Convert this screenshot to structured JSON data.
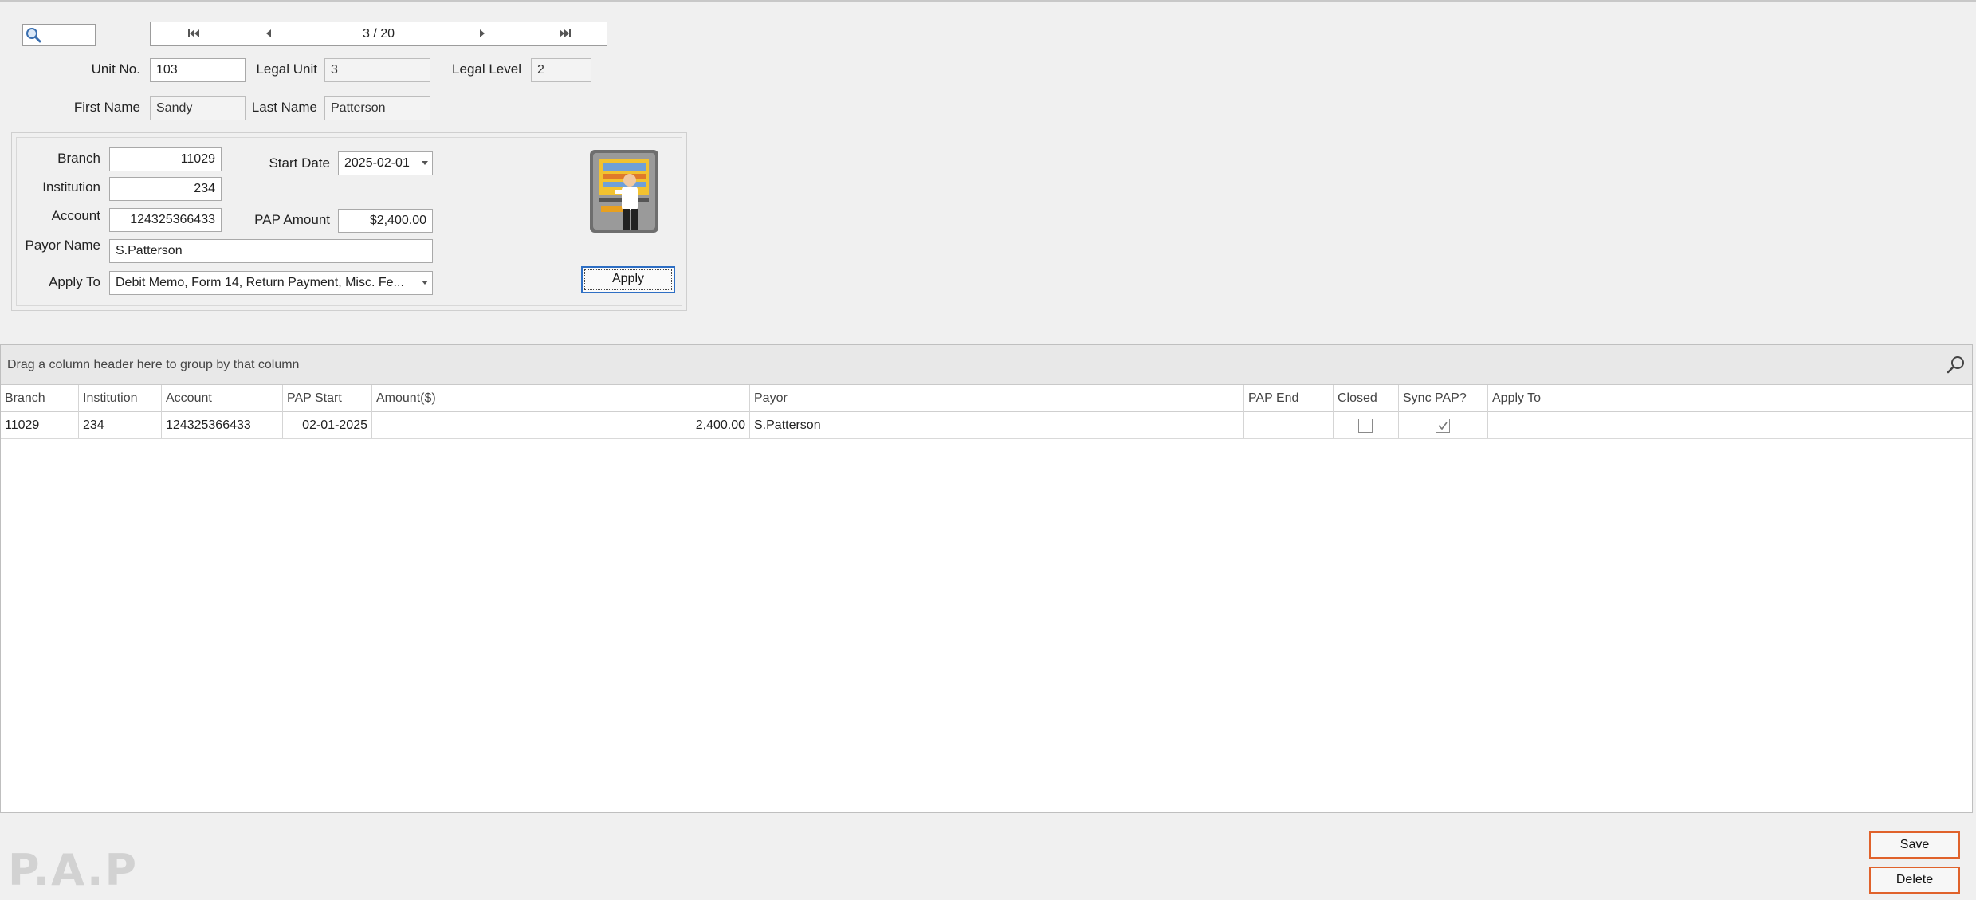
{
  "navigator": {
    "counter": "3 / 20",
    "first_icon": "first-record-icon",
    "prev_icon": "previous-record-icon",
    "next_icon": "next-record-icon",
    "last_icon": "last-record-icon",
    "search_icon": "magnifier-icon"
  },
  "unit": {
    "unit_no_label": "Unit No.",
    "unit_no": "103",
    "legal_unit_label": "Legal Unit",
    "legal_unit": "3",
    "legal_level_label": "Legal Level",
    "legal_level": "2",
    "first_name_label": "First Name",
    "first_name": "Sandy",
    "last_name_label": "Last Name",
    "last_name": "Patterson"
  },
  "pap_form": {
    "branch_label": "Branch",
    "branch": "11029",
    "institution_label": "Institution",
    "institution": "234",
    "account_label": "Account",
    "account": "124325366433",
    "payor_name_label": "Payor Name",
    "payor_name": "S.Patterson",
    "apply_to_label": "Apply To",
    "apply_to": "Debit Memo, Form 14, Return Payment, Misc. Fe...",
    "start_date_label": "Start Date",
    "start_date": "2025-02-01",
    "pap_amount_label": "PAP Amount",
    "pap_amount": "$2,400.00",
    "apply_button": "Apply",
    "illustration_icon": "atm-machine-icon"
  },
  "grid": {
    "group_panel_text": "Drag a column header here to group by that column",
    "search_icon": "search-icon",
    "columns": [
      "Branch",
      "Institution",
      "Account",
      "PAP Start",
      "Amount($)",
      "Payor",
      "PAP End",
      "Closed",
      "Sync PAP?",
      "Apply To"
    ],
    "rows": [
      {
        "branch": "11029",
        "institution": "234",
        "account": "124325366433",
        "pap_start": "02-01-2025",
        "amount": "2,400.00",
        "payor": "S.Patterson",
        "pap_end": "",
        "closed": false,
        "sync_pap": true,
        "apply_to": ""
      }
    ]
  },
  "footer": {
    "watermark": "P.A.P",
    "save_button": "Save",
    "delete_button": "Delete"
  },
  "colors": {
    "accent_focus": "#2e6fc4",
    "action_border": "#e0622b"
  }
}
